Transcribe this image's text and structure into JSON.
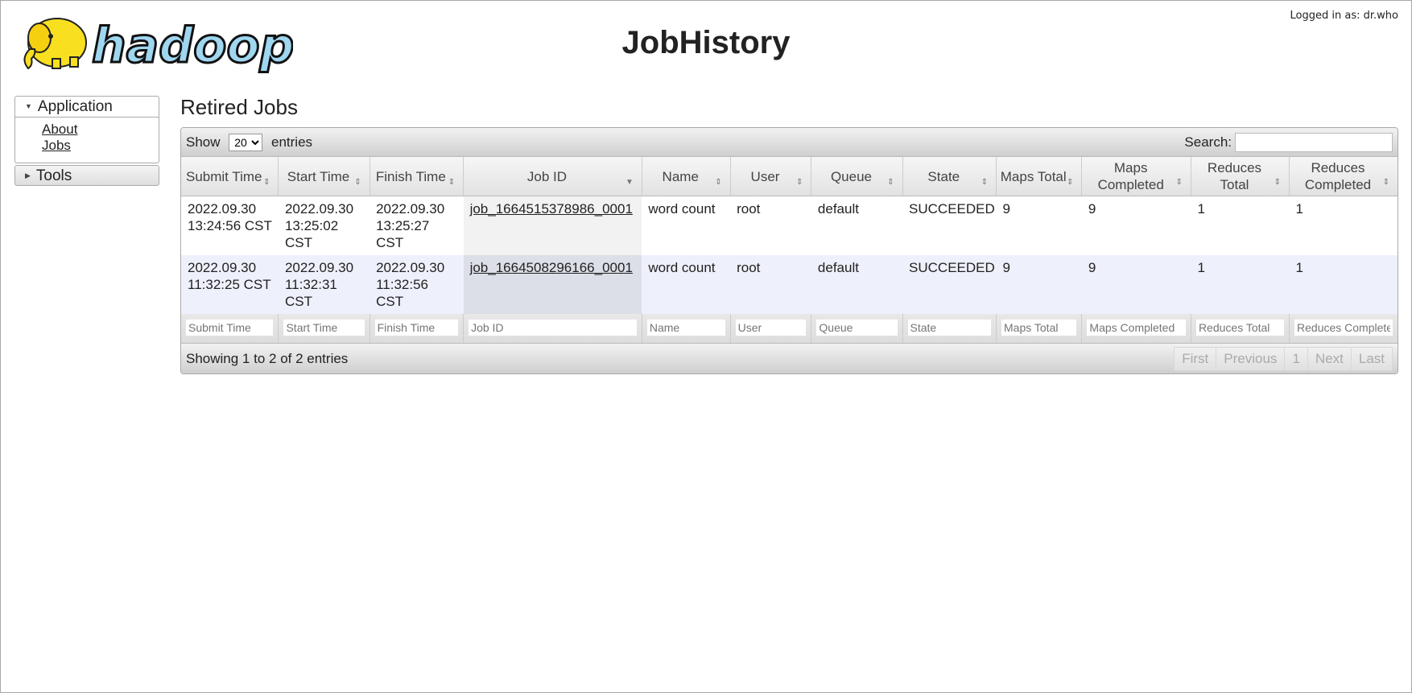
{
  "header": {
    "logo_text": "hadoop",
    "title": "JobHistory",
    "logged_in": "Logged in as: dr.who"
  },
  "sidebar": {
    "application": {
      "label": "Application",
      "links": [
        "About",
        "Jobs"
      ]
    },
    "tools": {
      "label": "Tools"
    }
  },
  "main": {
    "section_title": "Retired Jobs",
    "show_label": "Show",
    "show_value": "20",
    "entries_label": "entries",
    "search_label": "Search:",
    "columns": [
      "Submit Time",
      "Start Time",
      "Finish Time",
      "Job ID",
      "Name",
      "User",
      "Queue",
      "State",
      "Maps Total",
      "Maps Completed",
      "Reduces Total",
      "Reduces Completed"
    ],
    "rows": [
      [
        "2022.09.30 13:24:56 CST",
        "2022.09.30 13:25:02 CST",
        "2022.09.30 13:25:27 CST",
        "job_1664515378986_0001",
        "word count",
        "root",
        "default",
        "SUCCEEDED",
        "9",
        "9",
        "1",
        "1"
      ],
      [
        "2022.09.30 11:32:25 CST",
        "2022.09.30 11:32:31 CST",
        "2022.09.30 11:32:56 CST",
        "job_1664508296166_0001",
        "word count",
        "root",
        "default",
        "SUCCEEDED",
        "9",
        "9",
        "1",
        "1"
      ]
    ],
    "filters": [
      "Submit Time",
      "Start Time",
      "Finish Time",
      "Job ID",
      "Name",
      "User",
      "Queue",
      "State",
      "Maps Total",
      "Maps Completed",
      "Reduces Total",
      "Reduces Completed"
    ],
    "info": "Showing 1 to 2 of 2 entries",
    "pager": [
      "First",
      "Previous",
      "1",
      "Next",
      "Last"
    ]
  }
}
